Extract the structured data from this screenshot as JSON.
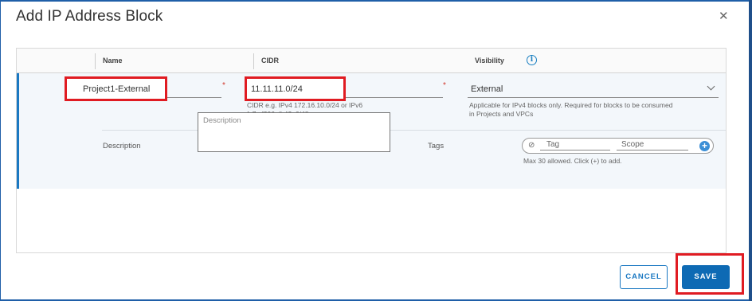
{
  "dialog": {
    "title": "Add IP Address Block",
    "close_icon": "close-icon"
  },
  "grid": {
    "columns": [
      "Name",
      "CIDR",
      "Visibility"
    ],
    "info_icon": "info-icon"
  },
  "row": {
    "name_value": "Project1-External",
    "name_required": "*",
    "cidr_value": "11.11.11.0/24",
    "cidr_required": "*",
    "cidr_hint_line1": "CIDR e.g. IPv4 172.16.10.0/24 or IPv6",
    "cidr_hint_line2": "fc7e:f206:db42::0/48",
    "visibility_value": "External",
    "visibility_hint_line1": "Applicable for IPv4 blocks only. Required for blocks to be consumed",
    "visibility_hint_line2": "in Projects and VPCs",
    "description_label": "Description",
    "description_placeholder": "Description",
    "tags_label": "Tags",
    "tag_placeholder": "Tag",
    "scope_placeholder": "Scope",
    "tags_hint": "Max 30 allowed. Click (+) to add."
  },
  "footer": {
    "cancel_label": "CANCEL",
    "save_label": "SAVE"
  },
  "colors": {
    "accent": "#0e6ab4",
    "highlight": "#e01b22",
    "required": "#d13a2e"
  }
}
